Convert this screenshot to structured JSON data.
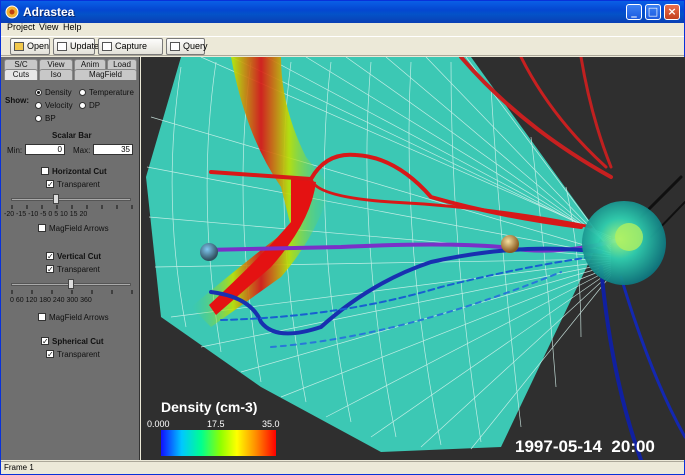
{
  "window": {
    "title": "Adrastea",
    "minimize": "_",
    "maximize": "□",
    "close": "×"
  },
  "menu": [
    "Project",
    "View",
    "Help"
  ],
  "toolbar": {
    "open": "Open",
    "update": "Update",
    "capture": "Capture Image",
    "query": "Query"
  },
  "tabs_row1": [
    "S/C Data",
    "View",
    "Anim",
    "Load"
  ],
  "tabs_row2": [
    "Cuts",
    "Iso",
    "MagField"
  ],
  "show": {
    "label": "Show:",
    "options": [
      "Density",
      "Temperature",
      "Velocity",
      "DP",
      "BP"
    ],
    "selected": "Density"
  },
  "scalar_bar": {
    "label": "Scalar Bar",
    "min_label": "Min:",
    "min_value": "0",
    "max_label": "Max:",
    "max_value": "35"
  },
  "horizontal_cut": {
    "label": "Horizontal Cut",
    "checked": false,
    "transparent_label": "Transparent",
    "transparent_checked": true,
    "ticks": "-20 -15 -10  -5   0   5  10  15  20",
    "slider_value": -5,
    "magfield_label": "MagField Arrows",
    "magfield_checked": false
  },
  "vertical_cut": {
    "label": "Vertical Cut",
    "checked": true,
    "transparent_label": "Transparent",
    "transparent_checked": true,
    "ticks": "0    60  120  180  240  300  360",
    "slider_value": 180,
    "magfield_label": "MagField Arrows",
    "magfield_checked": false
  },
  "spherical_cut": {
    "label": "Spherical Cut",
    "checked": true,
    "transparent_label": "Transparent",
    "transparent_checked": true
  },
  "legend": {
    "title": "Density (cm-3)",
    "min": "0.000",
    "mid": "17.5",
    "max": "35.0"
  },
  "timestamp": "1997-05-14  20:00",
  "status": "Frame 1",
  "colors": {
    "titlebar": "#0447d1",
    "viewport_bg": "#2f2f2f",
    "panel_bg": "#6f6f6f"
  }
}
